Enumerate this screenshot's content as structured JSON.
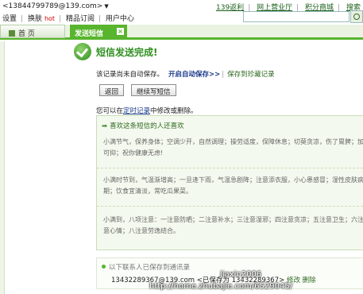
{
  "account": {
    "email": "<13844799789@139.com>"
  },
  "toplinks": {
    "settings": "设置",
    "change_skin": "换肤",
    "hot": "hot",
    "subscription": "精品订阅",
    "user_center": "用户中心"
  },
  "rightlinks": {
    "link1": "139返利",
    "link2": "网上营业厅",
    "link3": "积分商城",
    "link4": "搜索"
  },
  "tabs": {
    "home": "首 页",
    "sms": "发送短信"
  },
  "status": {
    "title": "短信发送完成!"
  },
  "notice": {
    "text": "该记录尚未自动保存。",
    "auto_save": "开启自动保存>>",
    "divider": "|",
    "save_collection": "保存到珍藏记录"
  },
  "buttons": {
    "back": "返回",
    "continue": "继续写短信"
  },
  "edit_note": {
    "prefix": "您可以在",
    "link": "定时记录",
    "suffix": "中修改或删除。"
  },
  "panel": {
    "title": "喜欢这条短信的人还喜欢",
    "messages": [
      {
        "l1": "小满节气，保养身体；空调少开，自然调理；操劳适度，保障休息；切莫贪凉，伤了胃脾；加强锻炼，",
        "l2": "可抑；祝你健康无虑!"
      },
      {
        "l1": "小满时节到，气温渐增高；一旦逢下雨，气温急剧降；注意添衣服，小心患感冒；湿性皮肤病，易发",
        "l2": "期；饮食宜清淡，常吃瓜果菜。"
      },
      {
        "l1": "小满到，八项注意：一注意防晒；二注意补水；三注意湿邪；四注意贪凉；五注意卫生；六注意饮食；",
        "l2": "意心情；八注意劳逸结合。"
      }
    ]
  },
  "saved": {
    "title": "以下联系人已保存到通讯录",
    "number": "13432289367@139.com",
    "saved_as_prefix": "<已保存为",
    "saved_as_number": "13432289367>",
    "edit": "修改",
    "delete": "删除"
  },
  "watermark": {
    "line1": "jiaxin2006",
    "line2": "http://home.zhubajie.com/6529045/"
  }
}
